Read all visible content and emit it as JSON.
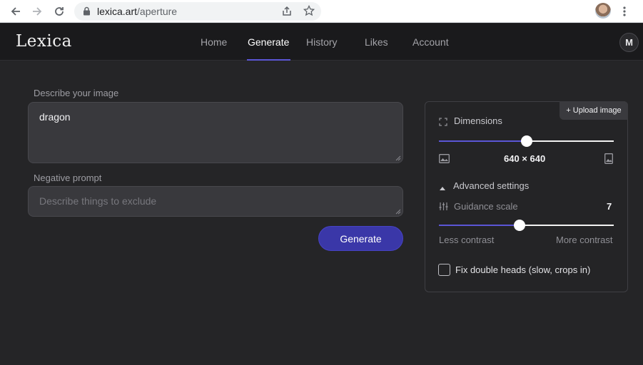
{
  "browser": {
    "url_host": "lexica.art",
    "url_path": "/aperture"
  },
  "app": {
    "logo": "Lexica",
    "nav": [
      "Home",
      "Generate",
      "History",
      "Likes",
      "Account"
    ],
    "active_nav": "Generate",
    "user_initial": "M"
  },
  "form": {
    "prompt_label": "Describe your image",
    "prompt_value": "dragon",
    "negative_label": "Negative prompt",
    "negative_placeholder": "Describe things to exclude",
    "generate_label": "Generate"
  },
  "settings": {
    "upload_label": "+ Upload image",
    "dimensions_label": "Dimensions",
    "dimensions_value": "640 × 640",
    "dimensions_slider": 0.5,
    "advanced_label": "Advanced settings",
    "guidance_label": "Guidance scale",
    "guidance_value": "7",
    "guidance_slider": 0.46,
    "less_contrast": "Less contrast",
    "more_contrast": "More contrast",
    "fix_heads_label": "Fix double heads (slow, crops in)",
    "fix_heads_checked": false
  },
  "colors": {
    "accent": "#5b56d6",
    "button": "#3a37a8"
  }
}
